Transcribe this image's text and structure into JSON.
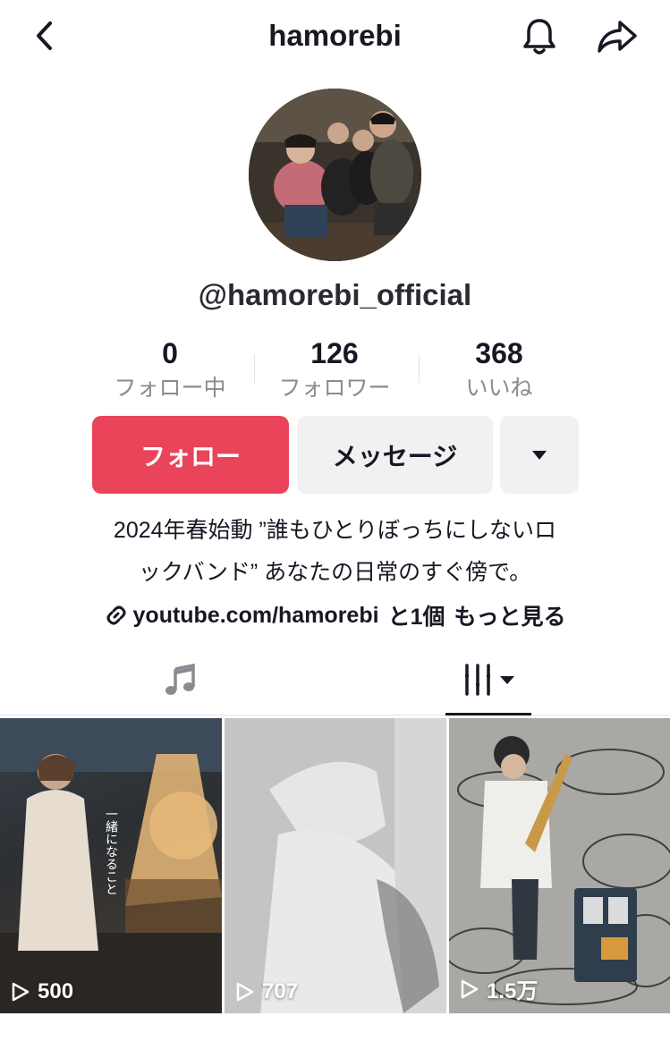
{
  "header": {
    "title": "hamorebi"
  },
  "profile": {
    "handle": "@hamorebi_official"
  },
  "stats": [
    {
      "value": "0",
      "label": "フォロー中"
    },
    {
      "value": "126",
      "label": "フォロワー"
    },
    {
      "value": "368",
      "label": "いいね"
    }
  ],
  "actions": {
    "follow": "フォロー",
    "message": "メッセージ"
  },
  "bio": {
    "line1": "2024年春始動 ”誰もひとりぼっちにしないロ",
    "line2": "ックバンド” あなたの日常のすぐ傍で。",
    "link": "youtube.com/hamorebi",
    "link_extra": "と1個",
    "more": "もっと見る"
  },
  "videos": [
    {
      "views": "500",
      "overlay_text": "一緒になること"
    },
    {
      "views": "707"
    },
    {
      "views": "1.5万"
    }
  ],
  "colors": {
    "follow_button": "#ea445a",
    "secondary_button": "#f1f1f2",
    "text": "#161823",
    "muted_text": "#8a8b91"
  }
}
